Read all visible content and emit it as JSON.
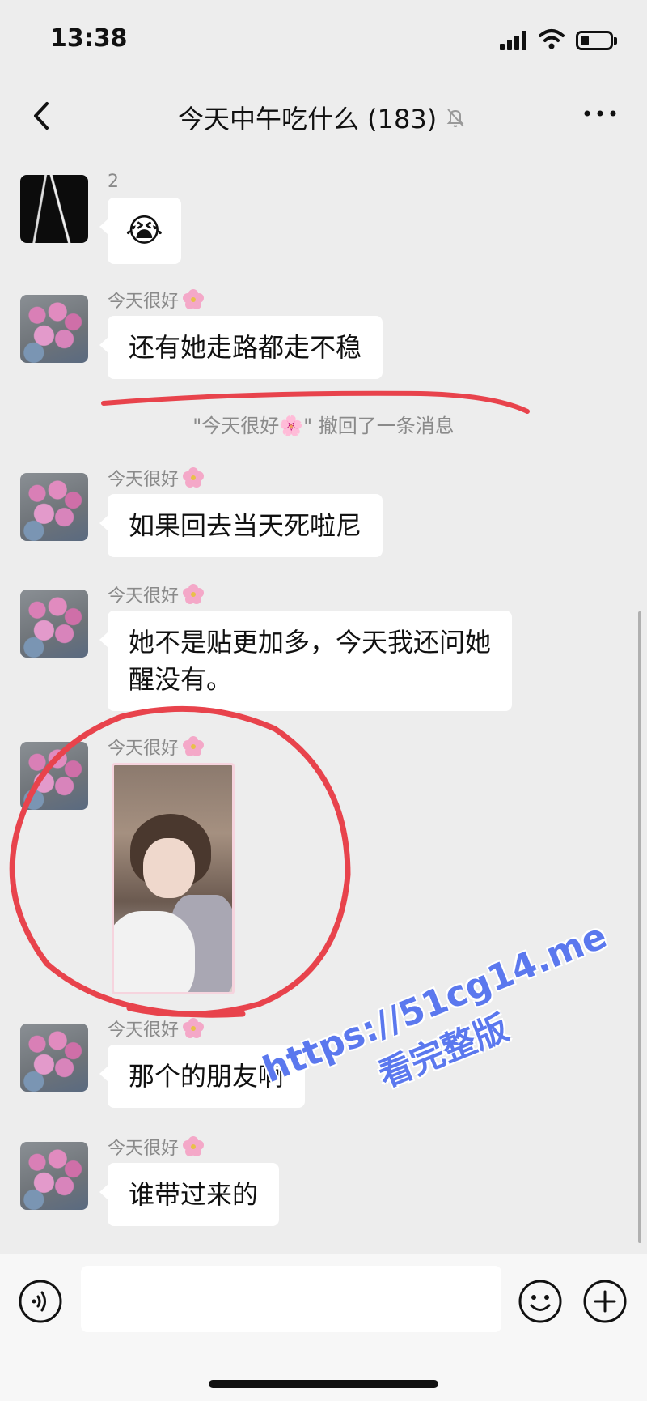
{
  "status": {
    "time": "13:38"
  },
  "nav": {
    "title": "今天中午吃什么 (183)"
  },
  "messages": [
    {
      "sender": "2",
      "emoji": "😭"
    },
    {
      "sender": "今天很好",
      "text": "还有她走路都走不稳"
    },
    {
      "system": "\"今天很好🌸\" 撤回了一条消息"
    },
    {
      "sender": "今天很好",
      "text": "如果回去当天死啦尼"
    },
    {
      "sender": "今天很好",
      "text_line1": "她不是贴更加多，今天我还问她",
      "text_line2": "醒没有。"
    },
    {
      "sender": "今天很好"
    },
    {
      "sender": "今天很好",
      "text": "那个的朋友啊"
    },
    {
      "sender": "今天很好",
      "text": "谁带过来的"
    }
  ],
  "watermark": {
    "line1": "https://51cg14.me",
    "line2": "看完整版"
  },
  "colors": {
    "background": "#ededed",
    "annotation": "#e8434c",
    "watermark": "#5b78ee"
  }
}
